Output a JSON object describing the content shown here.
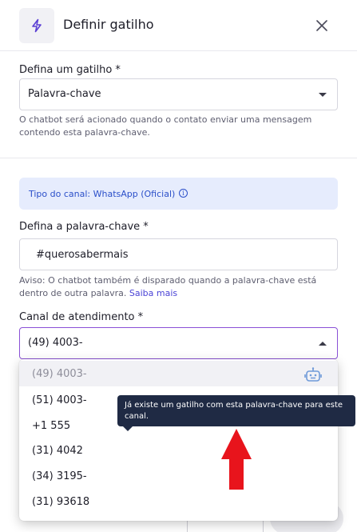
{
  "header": {
    "title": "Definir gatilho",
    "icon": "lightning-icon",
    "close_icon": "close-icon"
  },
  "trigger": {
    "label": "Defina um gatilho *",
    "selected": "Palavra-chave",
    "helper": "O chatbot será acionado quando o contato enviar uma mensagem contendo esta palavra-chave."
  },
  "channel_info": {
    "text": "Tipo do canal: WhatsApp (Oficial)",
    "icon": "info-icon"
  },
  "keyword": {
    "label": "Defina a palavra-chave  *",
    "value": "#querosabermais",
    "helper": "Aviso: O chatbot também é disparado quando a palavra-chave está dentro de outra palavra.",
    "link": "Saiba mais"
  },
  "service_channel": {
    "label": "Canal de atendimento *",
    "selected": "(49) 4003-",
    "options": [
      {
        "label": "(49) 4003-",
        "disabled": true
      },
      {
        "label": "(51) 4003-",
        "disabled": false
      },
      {
        "label": "+1 555",
        "disabled": false
      },
      {
        "label": "(31) 4042",
        "disabled": false
      },
      {
        "label": "(34) 3195-",
        "disabled": false
      },
      {
        "label": "(31) 9361​8",
        "disabled": false
      }
    ]
  },
  "tooltip": {
    "text": "Já existe um gatilho com esta palavra-chave para este canal."
  },
  "colors": {
    "accent": "#8a50d6",
    "info_bg": "#e6ecfd",
    "info_text": "#2b4fc9",
    "tooltip_bg": "#1f2a44",
    "annotation_arrow": "#e8141c"
  }
}
